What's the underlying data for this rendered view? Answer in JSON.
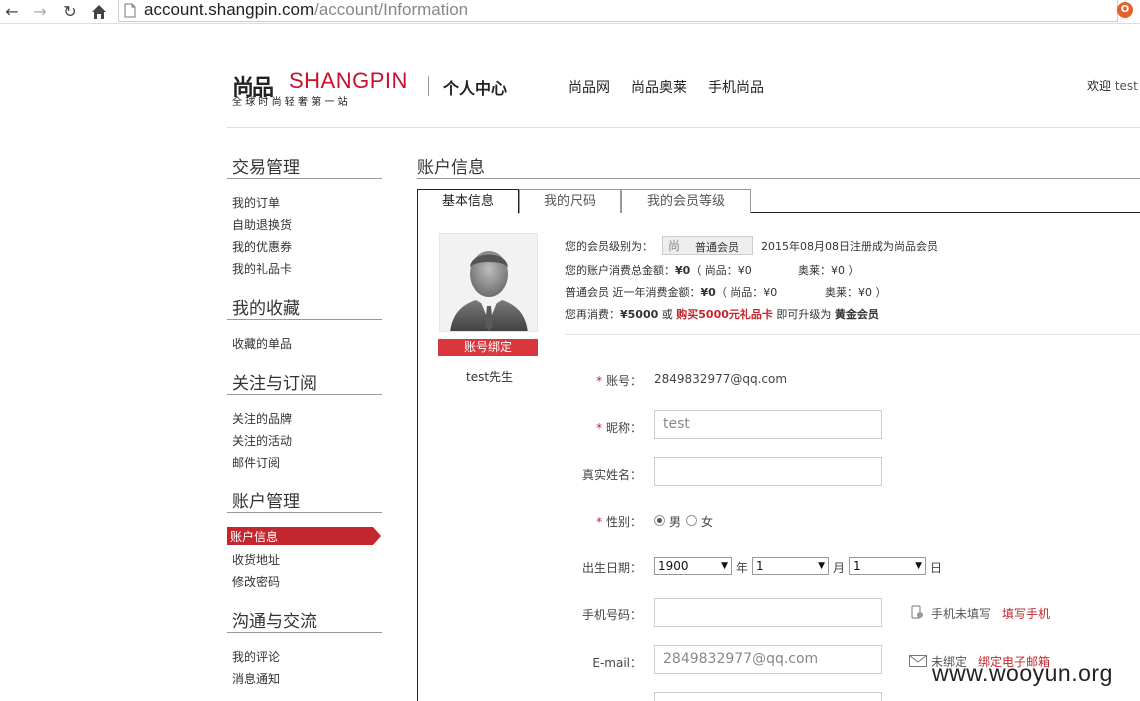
{
  "browser": {
    "url_host": "account.shangpin.com",
    "url_path": "/account/Information",
    "back_icon": "arrow-left-icon",
    "forward_icon": "arrow-right-icon",
    "reload_icon": "reload-icon",
    "home_icon": "home-icon"
  },
  "header": {
    "logo_mark": "尚品",
    "logo_text": "SHANGPIN",
    "logo_slogan": "全球时尚轻奢第一站",
    "section_title": "个人中心",
    "nav": [
      "尚品网",
      "尚品奥莱",
      "手机尚品"
    ],
    "welcome": "欢迎",
    "username": "test"
  },
  "sidebar": {
    "sections": [
      {
        "title": "交易管理",
        "items": [
          "我的订单",
          "自助退换货",
          "我的优惠券",
          "我的礼品卡"
        ]
      },
      {
        "title": "我的收藏",
        "items": [
          "收藏的单品"
        ]
      },
      {
        "title": "关注与订阅",
        "items": [
          "关注的品牌",
          "关注的活动",
          "邮件订阅"
        ]
      },
      {
        "title": "账户管理",
        "items": [
          "账户信息",
          "收货地址",
          "修改密码"
        ]
      },
      {
        "title": "沟通与交流",
        "items": [
          "我的评论",
          "消息通知"
        ]
      }
    ],
    "active_item": "账户信息"
  },
  "main": {
    "title": "账户信息",
    "tabs": [
      "基本信息",
      "我的尺码",
      "我的会员等级"
    ],
    "active_tab": "基本信息"
  },
  "profile": {
    "bind_button": "账号绑定",
    "display_name": "test先生"
  },
  "member": {
    "level_label": "您的会员级别为：",
    "level_icon": "尚",
    "level_name": "普通会员",
    "register_text": "2015年08月08日注册成为尚品会员",
    "total_prefix": "您的账户消费总金额：",
    "total_amount": "¥0",
    "total_detail": "（ 尚品：¥0",
    "total_outlet": "奥莱：¥0 ）",
    "year_prefix": "普通会员 近一年消费金额：",
    "year_amount": "¥0",
    "year_detail": "（ 尚品：¥0",
    "year_outlet": "奥莱：¥0 ）",
    "upgrade_prefix": "您再消费：",
    "upgrade_amount": "¥5000",
    "upgrade_or": " 或 ",
    "upgrade_link": "购买5000元礼品卡",
    "upgrade_mid": " 即可升级为 ",
    "upgrade_level": "黄金会员"
  },
  "form": {
    "account_label": "账号：",
    "account_value": "2849832977@qq.com",
    "nickname_label": "昵称：",
    "nickname_value": "test",
    "realname_label": "真实姓名：",
    "realname_value": "",
    "gender_label": "性别：",
    "gender_options": [
      "男",
      "女"
    ],
    "gender_selected": "男",
    "birth_label": "出生日期：",
    "birth_year": "1900",
    "birth_month": "1",
    "birth_day": "1",
    "unit_year": "年",
    "unit_month": "月",
    "unit_day": "日",
    "phone_label": "手机号码：",
    "phone_value": "",
    "phone_hint": "手机未填写",
    "phone_link": "填写手机",
    "email_label": "E-mail：",
    "email_value": "2849832977@qq.com",
    "email_hint": "未绑定",
    "email_link": "绑定电子邮箱",
    "required_mark": "*"
  },
  "watermark": "www.wooyun.org",
  "colors": {
    "brand_red": "#c1272d",
    "button_red": "#d9363e"
  }
}
